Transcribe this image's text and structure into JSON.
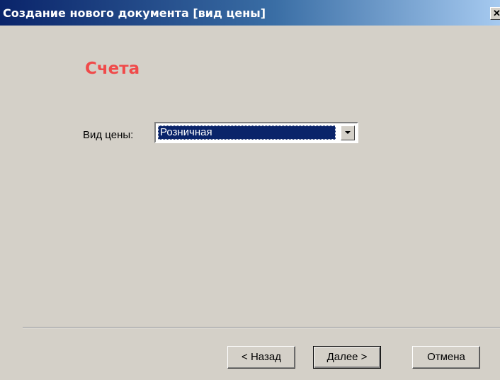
{
  "window": {
    "title": "Создание нового документа [вид цены]",
    "close_glyph": "✕"
  },
  "page": {
    "heading": "Счета",
    "price_type_label": "Вид цены:",
    "price_type_value": "Розничная"
  },
  "buttons": {
    "back": "< Назад",
    "next": "Далее >",
    "cancel": "Отмена"
  },
  "icons": {
    "combo_arrow": "chevron-down-icon"
  },
  "colors": {
    "heading": "#f04a4a",
    "titlebar_start": "#0a246a",
    "titlebar_end": "#a6caf0",
    "selection": "#0a246a",
    "dialog_bg": "#d4d0c8"
  }
}
